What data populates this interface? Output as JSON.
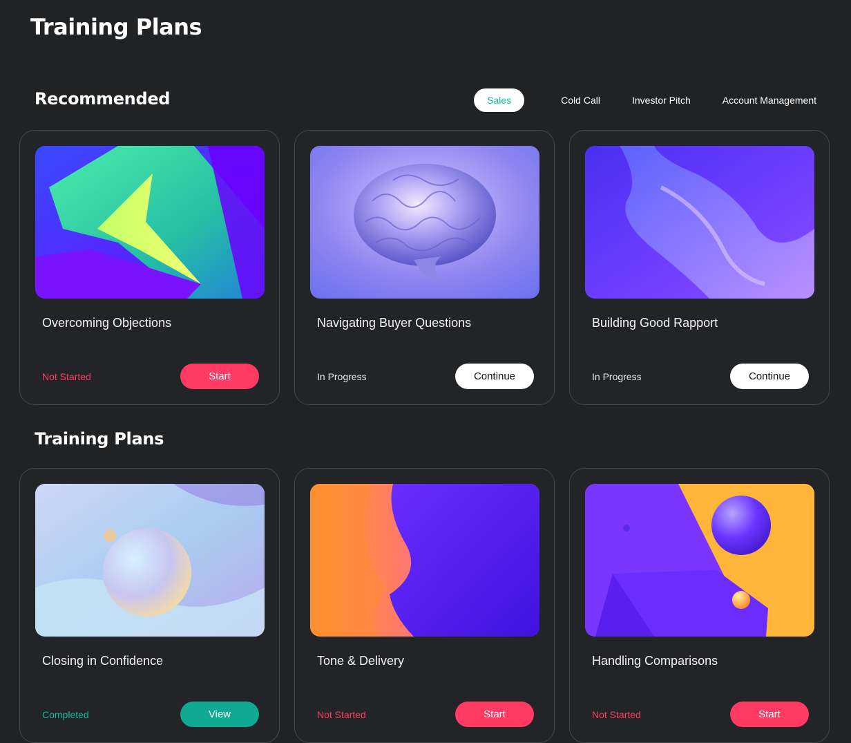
{
  "header": {
    "title": "Training Plans"
  },
  "recommended": {
    "title": "Recommended",
    "filters": [
      {
        "label": "Sales",
        "active": true
      },
      {
        "label": "Cold Call",
        "active": false
      },
      {
        "label": "Investor Pitch",
        "active": false
      },
      {
        "label": "Account Management",
        "active": false
      }
    ],
    "cards": [
      {
        "title": "Overcoming Objections",
        "status": "Not Started",
        "button": "Start",
        "image": "abstract-green-purple-shards"
      },
      {
        "title": "Navigating Buyer Questions",
        "status": "In Progress",
        "button": "Continue",
        "image": "brain-render"
      },
      {
        "title": "Building Good Rapport",
        "status": "In Progress",
        "button": "Continue",
        "image": "purple-silk-wave"
      }
    ]
  },
  "plans": {
    "title": "Training Plans",
    "cards": [
      {
        "title": "Closing in Confidence",
        "status": "Completed",
        "button": "View",
        "image": "pastel-sphere"
      },
      {
        "title": "Tone & Delivery",
        "status": "Not Started",
        "button": "Start",
        "image": "orange-purple-waves"
      },
      {
        "title": "Handling Comparisons",
        "status": "Not Started",
        "button": "Start",
        "image": "purple-orange-geometry-spheres"
      }
    ]
  },
  "colors": {
    "accent_pink": "#ff3b63",
    "accent_teal": "#13b89c",
    "background": "#212224"
  }
}
